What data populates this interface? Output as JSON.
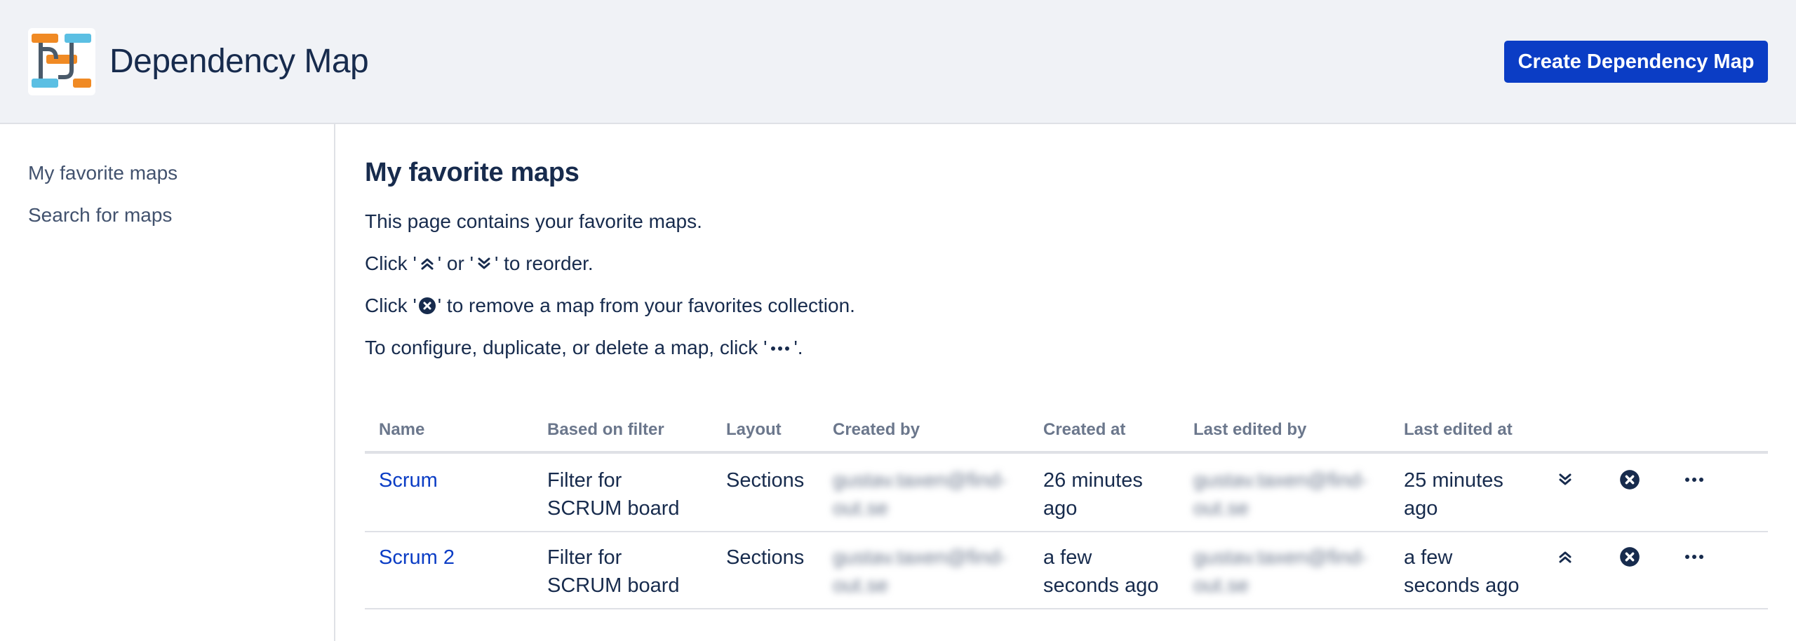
{
  "header": {
    "app_title": "Dependency Map",
    "create_button_label": "Create Dependency Map"
  },
  "sidebar": {
    "items": [
      {
        "label": "My favorite maps"
      },
      {
        "label": "Search for maps"
      }
    ]
  },
  "main": {
    "title": "My favorite maps",
    "intro": "This page contains your favorite maps.",
    "reorder": {
      "before": "Click '",
      "middle": "' or '",
      "after": "' to reorder."
    },
    "remove": {
      "before": "Click '",
      "after": "' to remove a map from your favorites collection."
    },
    "configure": {
      "before": "To configure, duplicate, or delete a map, click '",
      "after": "'."
    }
  },
  "table": {
    "columns": [
      "Name",
      "Based on filter",
      "Layout",
      "Created by",
      "Created at",
      "Last edited by",
      "Last edited at"
    ],
    "rows": [
      {
        "name": "Scrum",
        "filter_line1": "Filter for",
        "filter_line2": "SCRUM board",
        "layout": "Sections",
        "created_by_line1": "gustav.taxen@find-",
        "created_by_line2": "out.se",
        "created_at_line1": "26 minutes",
        "created_at_line2": "ago",
        "edited_by_line1": "gustav.taxen@find-",
        "edited_by_line2": "out.se",
        "edited_at_line1": "25 minutes",
        "edited_at_line2": "ago",
        "move_icon": "chevron-double-down-icon"
      },
      {
        "name": "Scrum 2",
        "filter_line1": "Filter for",
        "filter_line2": "SCRUM board",
        "layout": "Sections",
        "created_by_line1": "gustav.taxen@find-",
        "created_by_line2": "out.se",
        "created_at_line1": "a few",
        "created_at_line2": "seconds ago",
        "edited_by_line1": "gustav.taxen@find-",
        "edited_by_line2": "out.se",
        "edited_at_line1": "a few",
        "edited_at_line2": "seconds ago",
        "move_icon": "chevron-double-up-icon"
      }
    ]
  },
  "colors": {
    "header_bg": "#f0f2f6",
    "primary": "#0b3dc5",
    "text": "#172b4d",
    "muted": "#6b778c",
    "logo_orange": "#f08a24",
    "logo_blue": "#5bbfe3",
    "logo_dark": "#4a5a6a"
  }
}
